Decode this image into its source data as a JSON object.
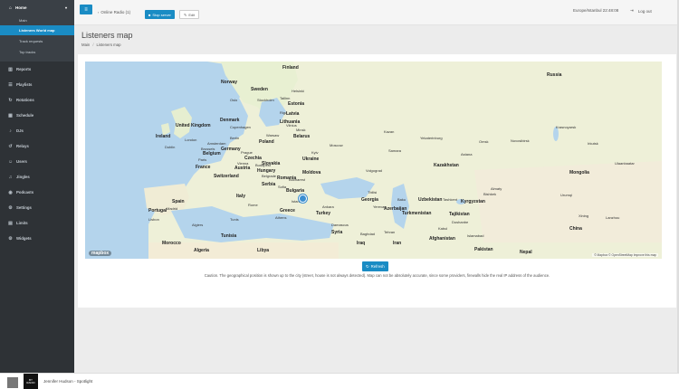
{
  "sidebar": {
    "home": "Home",
    "sub": [
      "Main",
      "Listeners World map",
      "Track requests",
      "Top tracks"
    ],
    "items": [
      "Reports",
      "Playlists",
      "Rotations",
      "Schedule",
      "DJs",
      "Relays",
      "Users",
      "Jingles",
      "Podcasts",
      "Settings",
      "Limits",
      "Widgets"
    ]
  },
  "topbar": {
    "radio": "Online Radio (1)",
    "stop": "Stop server",
    "edit": "Edit",
    "timezone": "Europe/Istanbul 22:48:08",
    "logout": "Log out"
  },
  "page": {
    "title": "Listeners map",
    "breadcrumb": [
      "Main",
      "Listeners map"
    ]
  },
  "map": {
    "attribution": "© Mapbox © OpenStreetMap  Improve this map",
    "logo": "mapbox",
    "countries": [
      "Finland",
      "Russia",
      "Norway",
      "Sweden",
      "Estonia",
      "Latvia",
      "Denmark",
      "Lithuania",
      "United Kingdom",
      "Ireland",
      "Belarus",
      "Poland",
      "Germany",
      "Belgium",
      "France",
      "Ukraine",
      "Czechia",
      "Slovakia",
      "Austria",
      "Hungary",
      "Romania",
      "Moldova",
      "Switzerland",
      "Serbia",
      "Bulgaria",
      "Italy",
      "Spain",
      "Portugal",
      "Greece",
      "Turkey",
      "Georgia",
      "Azerbaijan",
      "Kazakhstan",
      "Mongolia",
      "Uzbekistan",
      "Kyrgyzstan",
      "Turkmenistan",
      "Tajikistan",
      "Afghanistan",
      "Iran",
      "Iraq",
      "Syria",
      "Tunisia",
      "Morocco",
      "Algeria",
      "Libya",
      "China",
      "Pakistan",
      "Nepal"
    ],
    "cities": [
      "Moscow",
      "Kyiv",
      "Minsk",
      "Warsaw",
      "Berlin",
      "London",
      "Paris",
      "Madrid",
      "Rome",
      "Istanbul",
      "Ankara",
      "Tehran",
      "Tashkent",
      "Astana",
      "Almaty",
      "Baghdad",
      "Damascus",
      "Athens",
      "Sofia",
      "Belgrade",
      "Vienna",
      "Prague",
      "Budapest",
      "Bucharest",
      "Riga",
      "Vilnius",
      "Tallinn",
      "Helsinki",
      "Stockholm",
      "Oslo",
      "Copenhagen",
      "Amsterdam",
      "Brussels",
      "Dublin",
      "Lisbon",
      "Tunis",
      "Algiers",
      "Urumqi",
      "Novosibirsk",
      "Omsk",
      "Yekaterinburg",
      "Kazan",
      "Samara",
      "Volgograd",
      "Baku",
      "Tbilisi",
      "Yerevan",
      "Bishkek",
      "Dushanbe",
      "Kabul",
      "Islamabad",
      "Krasnoyarsk",
      "Irkutsk",
      "Ulaanbaatar",
      "Lanzhou",
      "Xining"
    ]
  },
  "refresh": "Refresh",
  "caution": "Caution. The geographical position is shown up to the city (street, house is not always detected). Map can not be absolutely accurate, since some providers, firewalls hide the real IP address of the audience.",
  "player": {
    "track": "Jennifer Hudson - Spotlight",
    "art_line1": "BY",
    "art_line2": "RADIO"
  }
}
